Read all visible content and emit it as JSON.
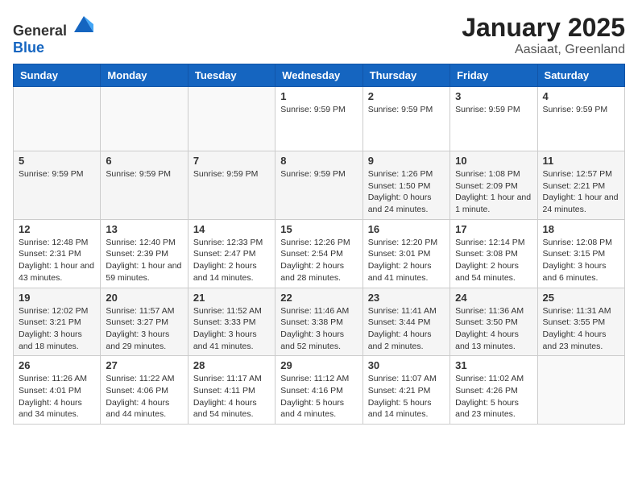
{
  "header": {
    "logo_general": "General",
    "logo_blue": "Blue",
    "month": "January 2025",
    "location": "Aasiaat, Greenland"
  },
  "days_of_week": [
    "Sunday",
    "Monday",
    "Tuesday",
    "Wednesday",
    "Thursday",
    "Friday",
    "Saturday"
  ],
  "weeks": [
    [
      {
        "num": "",
        "info": ""
      },
      {
        "num": "",
        "info": ""
      },
      {
        "num": "",
        "info": ""
      },
      {
        "num": "1",
        "info": "Sunrise: 9:59 PM"
      },
      {
        "num": "2",
        "info": "Sunrise: 9:59 PM"
      },
      {
        "num": "3",
        "info": "Sunrise: 9:59 PM"
      },
      {
        "num": "4",
        "info": "Sunrise: 9:59 PM"
      }
    ],
    [
      {
        "num": "5",
        "info": "Sunrise: 9:59 PM"
      },
      {
        "num": "6",
        "info": "Sunrise: 9:59 PM"
      },
      {
        "num": "7",
        "info": "Sunrise: 9:59 PM"
      },
      {
        "num": "8",
        "info": "Sunrise: 9:59 PM"
      },
      {
        "num": "9",
        "info": "Sunrise: 1:26 PM\nSunset: 1:50 PM\nDaylight: 0 hours and 24 minutes."
      },
      {
        "num": "10",
        "info": "Sunrise: 1:08 PM\nSunset: 2:09 PM\nDaylight: 1 hour and 1 minute."
      },
      {
        "num": "11",
        "info": "Sunrise: 12:57 PM\nSunset: 2:21 PM\nDaylight: 1 hour and 24 minutes."
      }
    ],
    [
      {
        "num": "12",
        "info": "Sunrise: 12:48 PM\nSunset: 2:31 PM\nDaylight: 1 hour and 43 minutes."
      },
      {
        "num": "13",
        "info": "Sunrise: 12:40 PM\nSunset: 2:39 PM\nDaylight: 1 hour and 59 minutes."
      },
      {
        "num": "14",
        "info": "Sunrise: 12:33 PM\nSunset: 2:47 PM\nDaylight: 2 hours and 14 minutes."
      },
      {
        "num": "15",
        "info": "Sunrise: 12:26 PM\nSunset: 2:54 PM\nDaylight: 2 hours and 28 minutes."
      },
      {
        "num": "16",
        "info": "Sunrise: 12:20 PM\nSunset: 3:01 PM\nDaylight: 2 hours and 41 minutes."
      },
      {
        "num": "17",
        "info": "Sunrise: 12:14 PM\nSunset: 3:08 PM\nDaylight: 2 hours and 54 minutes."
      },
      {
        "num": "18",
        "info": "Sunrise: 12:08 PM\nSunset: 3:15 PM\nDaylight: 3 hours and 6 minutes."
      }
    ],
    [
      {
        "num": "19",
        "info": "Sunrise: 12:02 PM\nSunset: 3:21 PM\nDaylight: 3 hours and 18 minutes."
      },
      {
        "num": "20",
        "info": "Sunrise: 11:57 AM\nSunset: 3:27 PM\nDaylight: 3 hours and 29 minutes."
      },
      {
        "num": "21",
        "info": "Sunrise: 11:52 AM\nSunset: 3:33 PM\nDaylight: 3 hours and 41 minutes."
      },
      {
        "num": "22",
        "info": "Sunrise: 11:46 AM\nSunset: 3:38 PM\nDaylight: 3 hours and 52 minutes."
      },
      {
        "num": "23",
        "info": "Sunrise: 11:41 AM\nSunset: 3:44 PM\nDaylight: 4 hours and 2 minutes."
      },
      {
        "num": "24",
        "info": "Sunrise: 11:36 AM\nSunset: 3:50 PM\nDaylight: 4 hours and 13 minutes."
      },
      {
        "num": "25",
        "info": "Sunrise: 11:31 AM\nSunset: 3:55 PM\nDaylight: 4 hours and 23 minutes."
      }
    ],
    [
      {
        "num": "26",
        "info": "Sunrise: 11:26 AM\nSunset: 4:01 PM\nDaylight: 4 hours and 34 minutes."
      },
      {
        "num": "27",
        "info": "Sunrise: 11:22 AM\nSunset: 4:06 PM\nDaylight: 4 hours and 44 minutes."
      },
      {
        "num": "28",
        "info": "Sunrise: 11:17 AM\nSunset: 4:11 PM\nDaylight: 4 hours and 54 minutes."
      },
      {
        "num": "29",
        "info": "Sunrise: 11:12 AM\nSunset: 4:16 PM\nDaylight: 5 hours and 4 minutes."
      },
      {
        "num": "30",
        "info": "Sunrise: 11:07 AM\nSunset: 4:21 PM\nDaylight: 5 hours and 14 minutes."
      },
      {
        "num": "31",
        "info": "Sunrise: 11:02 AM\nSunset: 4:26 PM\nDaylight: 5 hours and 23 minutes."
      },
      {
        "num": "",
        "info": ""
      }
    ]
  ]
}
